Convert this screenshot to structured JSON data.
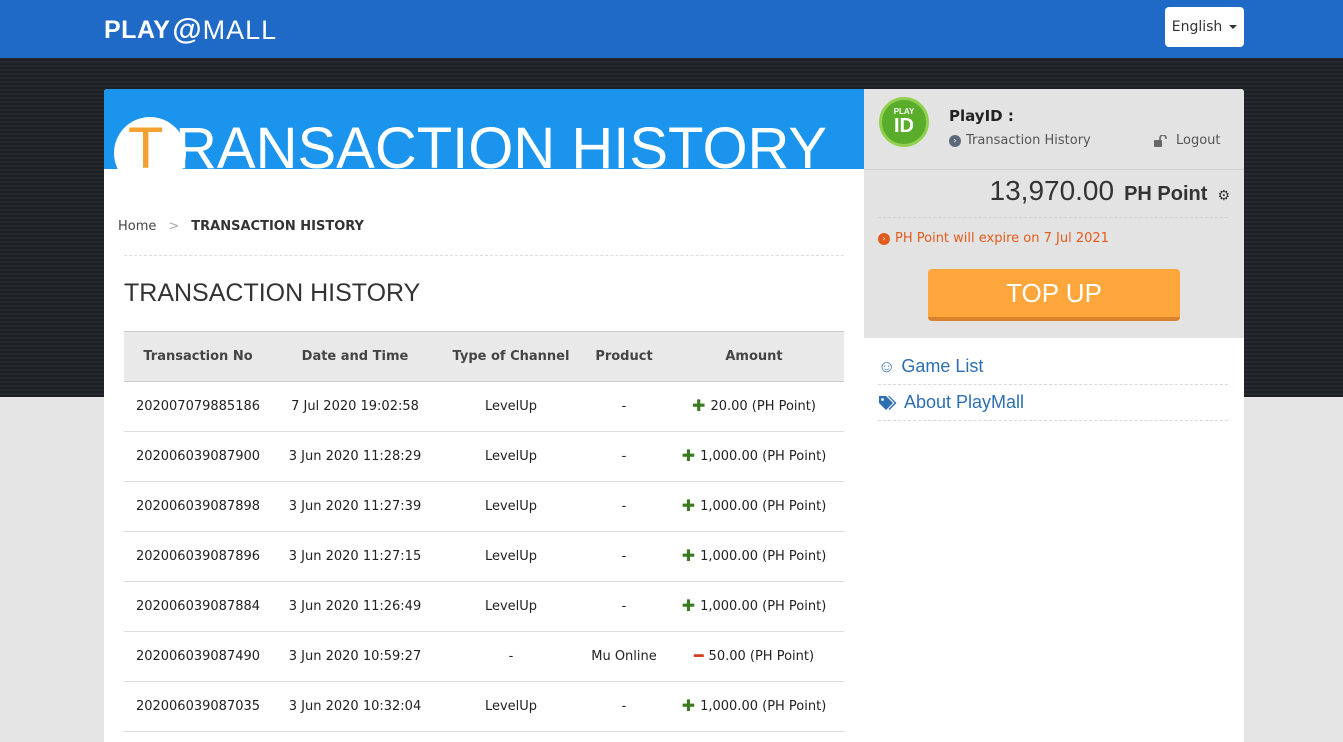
{
  "header": {
    "logo_play": "PLAY",
    "logo_at": "@",
    "logo_mall": "MALL",
    "language": "English"
  },
  "banner": {
    "first_letter": "T",
    "rest": "RANSACTION HISTORY"
  },
  "breadcrumb": {
    "home": "Home",
    "separator": ">",
    "current": "TRANSACTION HISTORY"
  },
  "page_title": "TRANSACTION HISTORY",
  "table": {
    "columns": [
      "Transaction No",
      "Date and Time",
      "Type of Channel",
      "Product",
      "Amount"
    ],
    "rows": [
      {
        "no": "202007079885186",
        "datetime": "7 Jul 2020 19:02:58",
        "channel": "LevelUp",
        "product": "-",
        "sign": "+",
        "amount": "20.00 (PH Point)"
      },
      {
        "no": "202006039087900",
        "datetime": "3 Jun 2020 11:28:29",
        "channel": "LevelUp",
        "product": "-",
        "sign": "+",
        "amount": "1,000.00 (PH Point)"
      },
      {
        "no": "202006039087898",
        "datetime": "3 Jun 2020 11:27:39",
        "channel": "LevelUp",
        "product": "-",
        "sign": "+",
        "amount": "1,000.00 (PH Point)"
      },
      {
        "no": "202006039087896",
        "datetime": "3 Jun 2020 11:27:15",
        "channel": "LevelUp",
        "product": "-",
        "sign": "+",
        "amount": "1,000.00 (PH Point)"
      },
      {
        "no": "202006039087884",
        "datetime": "3 Jun 2020 11:26:49",
        "channel": "LevelUp",
        "product": "-",
        "sign": "+",
        "amount": "1,000.00 (PH Point)"
      },
      {
        "no": "202006039087490",
        "datetime": "3 Jun 2020 10:59:27",
        "channel": "-",
        "product": "Mu Online",
        "sign": "-",
        "amount": "50.00 (PH Point)"
      },
      {
        "no": "202006039087035",
        "datetime": "3 Jun 2020 10:32:04",
        "channel": "LevelUp",
        "product": "-",
        "sign": "+",
        "amount": "1,000.00 (PH Point)"
      }
    ]
  },
  "sidebar": {
    "badge_top": "PLAY",
    "badge_bottom": "ID",
    "playid_label": "PlayID :",
    "transaction_history_link": "Transaction History",
    "logout": "Logout",
    "balance": "13,970.00",
    "balance_unit": "PH Point",
    "expire_notice": "PH Point will expire on 7 Jul 2021",
    "topup_label": "TOP UP",
    "menu": [
      {
        "label": "Game List",
        "icon": "smile-icon"
      },
      {
        "label": "About PlayMall",
        "icon": "tags-icon"
      }
    ]
  },
  "colors": {
    "header_blue": "#1f6ac7",
    "banner_blue": "#1a94ec",
    "accent_orange": "#fda63b",
    "link_blue": "#2d6fb0",
    "plus_green": "#3c7a22",
    "minus_red": "#d23b1c",
    "warning_orange": "#e35b1b"
  }
}
